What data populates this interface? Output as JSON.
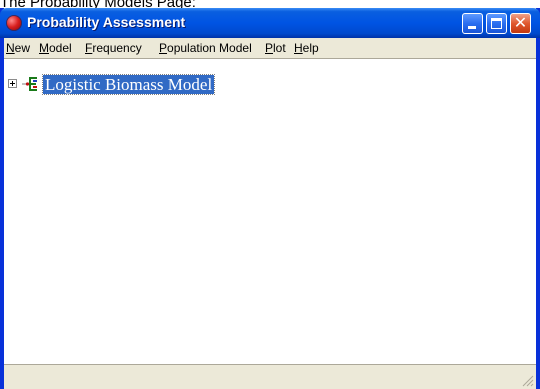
{
  "caption": "The Probability Models Page:",
  "window": {
    "title": "Probability Assessment",
    "icon": "app-globe-icon",
    "controls": [
      "minimize-icon",
      "maximize-icon",
      "close-icon"
    ],
    "close_glyph": "✕"
  },
  "menu": {
    "items": [
      {
        "mnemonic": "N",
        "rest": "ew"
      },
      {
        "mnemonic": "M",
        "rest": "odel"
      },
      {
        "mnemonic": "F",
        "rest": "requency"
      },
      {
        "mnemonic": "P",
        "rest": "opulation Model"
      },
      {
        "mnemonic": "P",
        "rest": "lot"
      },
      {
        "mnemonic": "H",
        "rest": "elp"
      }
    ]
  },
  "tree": {
    "nodes": [
      {
        "label": "Logistic Biomass Model",
        "expanded": false,
        "selected": true,
        "icon": "model-node-icon"
      }
    ]
  },
  "colors": {
    "titlebar": "#0054e3",
    "selection": "#316ac5",
    "chrome": "#ece9d8"
  }
}
